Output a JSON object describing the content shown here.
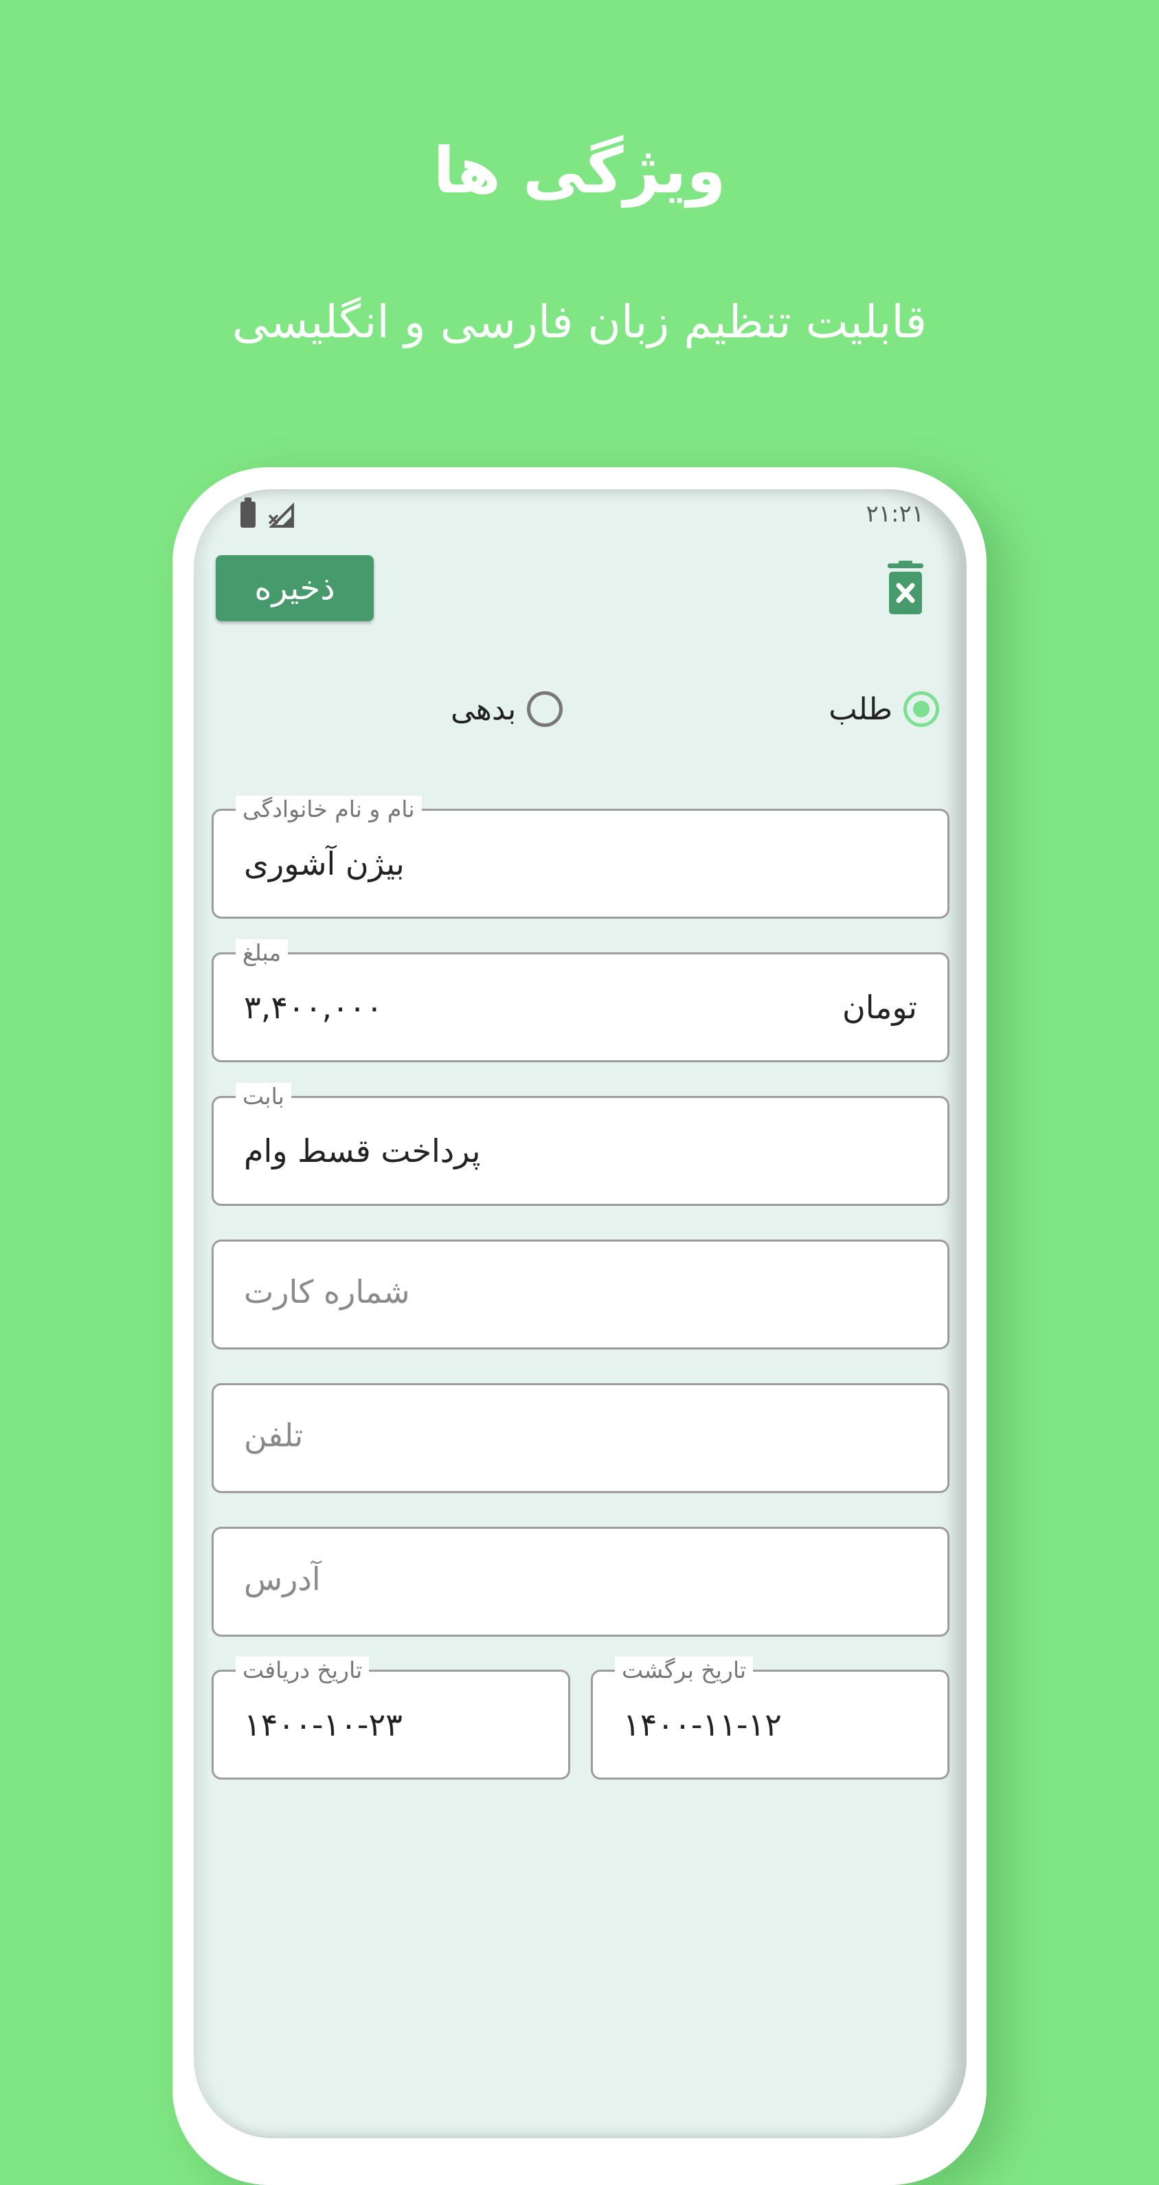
{
  "hero": {
    "title": "ویژگی ها",
    "subtitle": "قابلیت تنظیم زبان فارسی و انگلیسی"
  },
  "status_bar": {
    "time": "۲۱:۲۱"
  },
  "toolbar": {
    "save_label": "ذخیره",
    "delete_icon": "trash-x-icon"
  },
  "type_selector": {
    "options": [
      {
        "label": "طلب",
        "selected": true
      },
      {
        "label": "بدهی",
        "selected": false
      }
    ]
  },
  "form": {
    "name": {
      "label": "نام و نام خانوادگی",
      "value": "بیژن آشوری"
    },
    "amount": {
      "label": "مبلغ",
      "value": "۳,۴۰۰,۰۰۰",
      "unit": "تومان"
    },
    "reason": {
      "label": "بابت",
      "value": "پرداخت قسط وام"
    },
    "card_number": {
      "placeholder": "شماره کارت"
    },
    "phone": {
      "placeholder": "تلفن"
    },
    "address": {
      "placeholder": "آدرس"
    },
    "received_date": {
      "label": "تاریخ دریافت",
      "value": "۱۴۰۰-۱۰-۲۳"
    },
    "return_date": {
      "label": "تاریخ برگشت",
      "value": "۱۴۰۰-۱۱-۱۲"
    }
  },
  "colors": {
    "background": "#80e583",
    "accent": "#469a6b",
    "radio_selected": "#7ddf90",
    "screen": "#e6f2ee"
  }
}
